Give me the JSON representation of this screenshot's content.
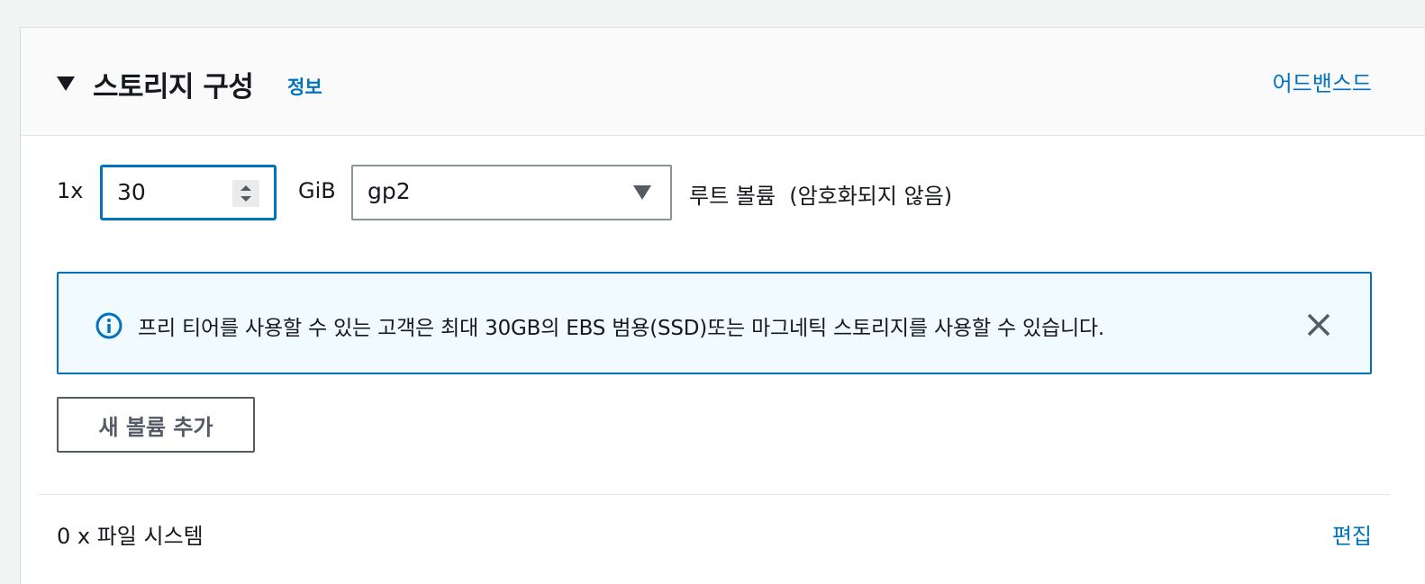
{
  "section": {
    "title": "스토리지 구성",
    "info_link": "정보",
    "advanced_link": "어드밴스드"
  },
  "volume": {
    "multiplier": "1x",
    "size_value": "30",
    "size_unit": "GiB",
    "volume_type": "gp2",
    "root_label": "루트 볼륨  (암호화되지 않음)"
  },
  "alert": {
    "message": "프리 티어를 사용할 수 있는 고객은 최대 30GB의 EBS 범용(SSD)또는 마그네틱 스토리지를 사용할 수 있습니다."
  },
  "actions": {
    "add_volume": "새 볼륨 추가"
  },
  "filesystems": {
    "summary": "0 x 파일 시스템",
    "edit_link": "편집"
  },
  "colors": {
    "accent": "#0073bb",
    "alert_bg": "#f1faff",
    "page_bg": "#f2f3f3"
  },
  "icons": {
    "collapse": "caret-down-icon",
    "info": "info-circle-icon",
    "close": "close-icon",
    "spinner": "stepper-icon",
    "select": "caret-down-icon"
  }
}
